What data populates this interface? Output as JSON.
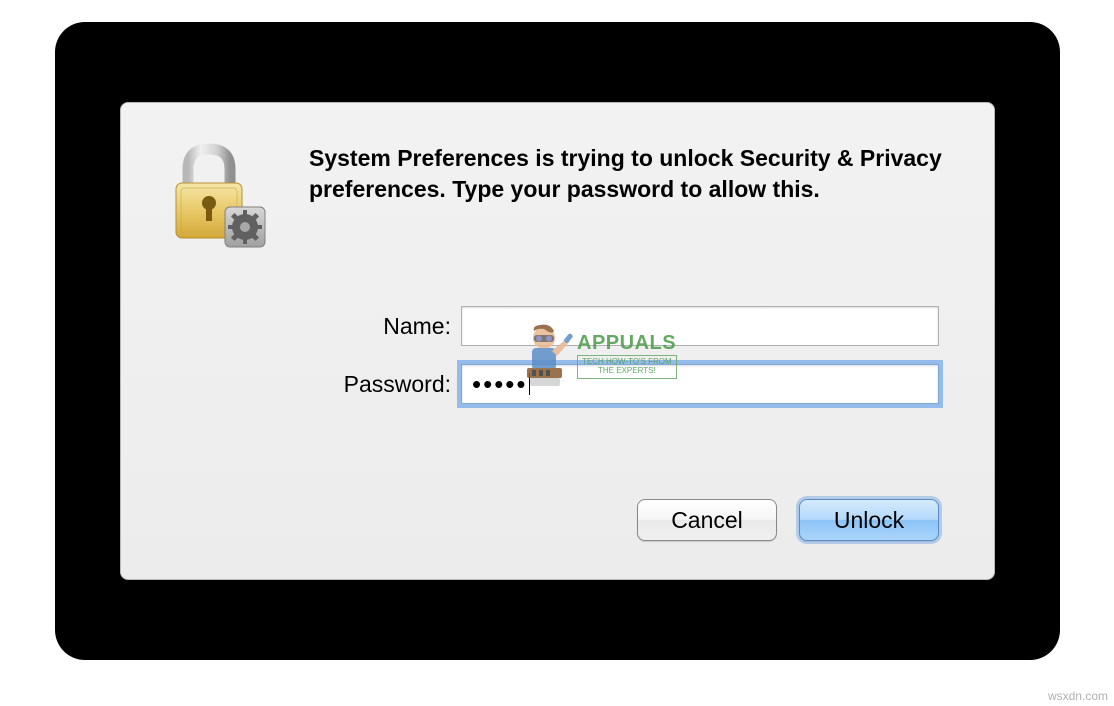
{
  "dialog": {
    "message": "System Preferences is trying to unlock Security & Privacy preferences. Type your password to allow this.",
    "fields": {
      "name": {
        "label": "Name:",
        "value": ""
      },
      "password": {
        "label": "Password:",
        "value": "•••••"
      }
    },
    "buttons": {
      "cancel": "Cancel",
      "unlock": "Unlock"
    }
  },
  "icon": {
    "name": "security-lock-icon"
  },
  "watermark": {
    "title": "APPUALS",
    "subtitle_line1": "TECH HOW-TO'S FROM",
    "subtitle_line2": "THE EXPERTS!",
    "credit": "wsxdn.com"
  }
}
